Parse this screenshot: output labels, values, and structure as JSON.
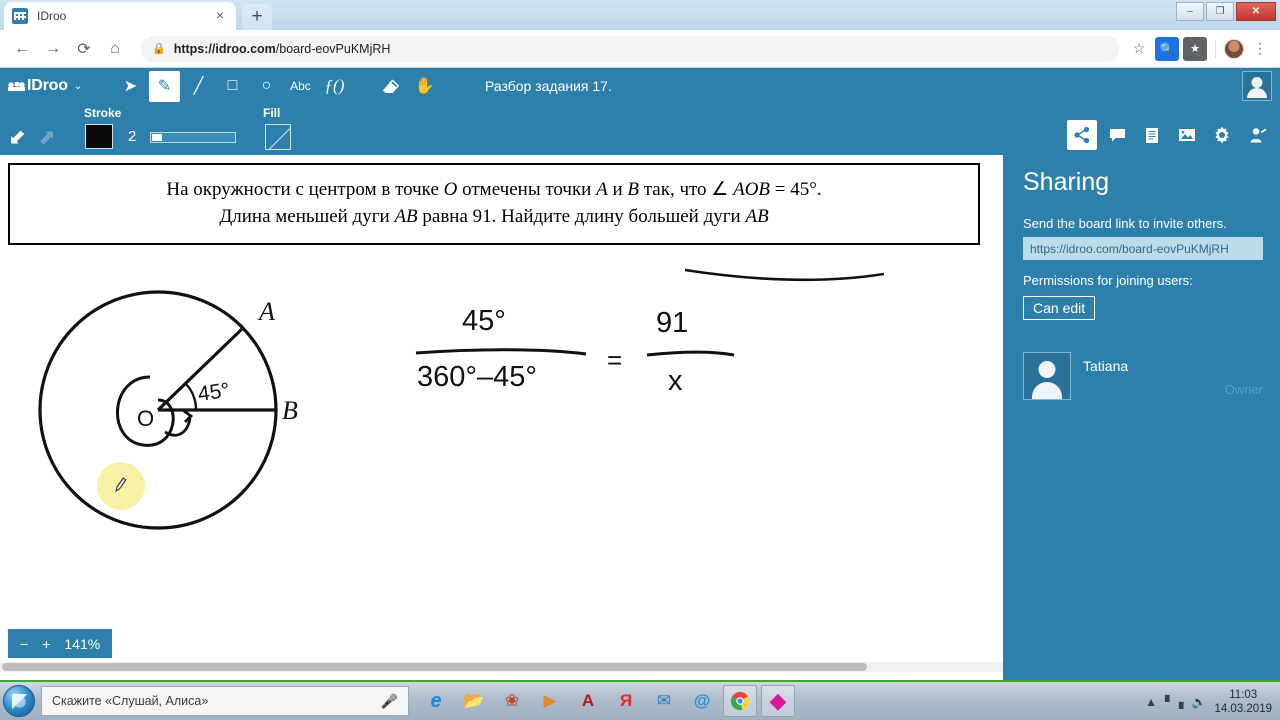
{
  "browser": {
    "tab": {
      "title": "IDroo",
      "favicon": "idroo-favicon",
      "close_label": "×"
    },
    "new_tab_label": "+",
    "window_controls": {
      "minimize": "–",
      "maximize": "❐",
      "close": "✕"
    },
    "nav": {
      "back": "←",
      "forward": "→",
      "reload": "⟳",
      "home": "⌂"
    },
    "url": {
      "lock": "🔒",
      "host": "https://idroo.com",
      "path": "/board-eovPuKMjRH"
    },
    "omnibox_icons": {
      "bookmark": "☆",
      "search_ext": "🔍",
      "star_ext": "★",
      "menu": "⋮"
    }
  },
  "idroo": {
    "brand": "IDroo",
    "brand_caret": "⌄",
    "board_title": "Разбор задания 17.",
    "tools": [
      {
        "name": "select-tool",
        "glyph": "➤",
        "active": false
      },
      {
        "name": "pencil-tool",
        "glyph": "✎",
        "active": true
      },
      {
        "name": "line-tool",
        "glyph": "╱",
        "active": false
      },
      {
        "name": "rectangle-tool",
        "glyph": "□",
        "active": false
      },
      {
        "name": "ellipse-tool",
        "glyph": "○",
        "active": false
      },
      {
        "name": "text-tool",
        "glyph": "Abc",
        "active": false
      },
      {
        "name": "formula-tool",
        "glyph": "ƒ()",
        "active": false
      },
      {
        "name": "eraser-tool",
        "glyph": "◢",
        "active": false
      },
      {
        "name": "hand-tool",
        "glyph": "✋",
        "active": false
      }
    ],
    "properties": {
      "undo": "⬋",
      "redo": "⬈",
      "stroke_label": "Stroke",
      "stroke_color": "#000000",
      "stroke_width": "2",
      "fill_label": "Fill",
      "fill_value": "none"
    },
    "zoom": {
      "minus": "−",
      "plus": "+",
      "value": "141%"
    }
  },
  "problem": {
    "line1_parts": {
      "a": "На окружности с центром в точке ",
      "O": "O",
      "b": " отмечены точки ",
      "A": "A",
      "c": " и ",
      "B": "B",
      "d": " так, что  ∠ ",
      "AOB": "AOB",
      "e": " = 45°."
    },
    "line2_parts": {
      "a": "Длина меньшей дуги ",
      "AB1": "AB",
      "b": " равна 91. Найдите длину большей дуги ",
      "AB2": "AB"
    }
  },
  "drawing": {
    "circle_labels": {
      "A": "A",
      "B": "B",
      "O": "O",
      "angle": "45°"
    },
    "equation": {
      "left_numerator": "45°",
      "left_denominator": "360°–45°",
      "equals": "=",
      "right_numerator": "91",
      "right_denominator": "x"
    }
  },
  "sidebar": {
    "icons": [
      {
        "name": "share-icon",
        "glyph": "↱",
        "active": true
      },
      {
        "name": "chat-icon",
        "glyph": "💬",
        "active": false
      },
      {
        "name": "document-icon",
        "glyph": "🗉",
        "active": false
      },
      {
        "name": "image-icon",
        "glyph": "🖼",
        "active": false
      },
      {
        "name": "settings-gear-icon",
        "glyph": "⚙",
        "active": false
      },
      {
        "name": "invite-user-icon",
        "glyph": "👤",
        "active": false
      }
    ],
    "title": "Sharing",
    "subtitle": "Send the board link to invite others.",
    "board_link": "https://idroo.com/board-eovPuKMjRH",
    "permissions_label": "Permissions for joining users:",
    "permission_value": "Can edit",
    "member": {
      "name": "Tatiana",
      "role": "Owner"
    }
  },
  "taskbar": {
    "start": "start-orb",
    "search_placeholder": "Скажите «Слушай, Алиса»",
    "mic": "🎤",
    "apps": [
      {
        "name": "internet-explorer-icon",
        "glyph": "e",
        "color": "#1c8ad8",
        "boxed": false
      },
      {
        "name": "file-explorer-icon",
        "glyph": "🗀",
        "color": "#d8a43a",
        "boxed": false
      },
      {
        "name": "media-app-icon",
        "glyph": "❀",
        "color": "#c2452c",
        "boxed": false
      },
      {
        "name": "media-player-icon",
        "glyph": "▶",
        "color": "#e08b26",
        "boxed": false
      },
      {
        "name": "autocad-icon",
        "glyph": "A",
        "color": "#b01a1a",
        "boxed": false
      },
      {
        "name": "yandex-icon",
        "glyph": "Я",
        "color": "#e02f2f",
        "boxed": false
      },
      {
        "name": "mail-icon",
        "glyph": "✉",
        "color": "#2a7fc4",
        "boxed": false
      },
      {
        "name": "mailru-icon",
        "glyph": "@",
        "color": "#1e8fd6",
        "boxed": false
      },
      {
        "name": "chrome-icon",
        "glyph": "◉",
        "color": "#3ba34a",
        "boxed": true
      },
      {
        "name": "diamond-app-icon",
        "glyph": "◆",
        "color": "#d6189c",
        "boxed": true
      }
    ],
    "tray": {
      "arrow": "▲",
      "network": "◥",
      "volume": "🔊"
    },
    "clock": {
      "time": "11:03",
      "date": "14.03.2019"
    }
  },
  "colors": {
    "idroo_blue": "#2e80ac",
    "sidebar_blue": "#2e80ac",
    "highlight_yellow": "#f7f0a0",
    "taskbar_green": "#3fa535"
  }
}
